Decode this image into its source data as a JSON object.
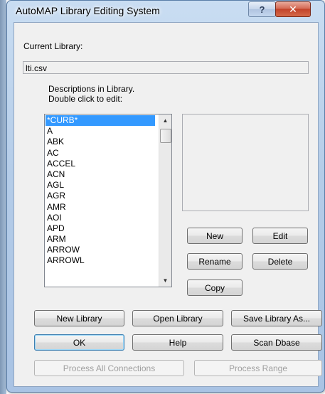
{
  "window": {
    "title": "AutoMAP Library Editing System",
    "help_glyph": "?",
    "close_glyph": "✕"
  },
  "current_library": {
    "label": "Current Library:",
    "value": "lti.csv"
  },
  "instructions": {
    "line1": "Descriptions in Library.",
    "line2": "Double click to edit:"
  },
  "list": {
    "selected_index": 0,
    "items": [
      "*CURB*",
      "A",
      "ABK",
      "AC",
      "ACCEL",
      "ACN",
      "AGL",
      "AGR",
      "AMR",
      "AOI",
      "APD",
      "ARM",
      "ARROW",
      "ARROWL"
    ]
  },
  "buttons": {
    "new": "New",
    "edit": "Edit",
    "rename": "Rename",
    "delete": "Delete",
    "copy": "Copy",
    "new_library": "New Library",
    "open_library": "Open Library",
    "save_library_as": "Save Library As...",
    "ok": "OK",
    "help": "Help",
    "scan_dbase": "Scan Dbase",
    "process_all_connections": "Process All Connections",
    "process_range": "Process Range"
  },
  "scrollbar": {
    "up_glyph": "▲",
    "down_glyph": "▼"
  }
}
